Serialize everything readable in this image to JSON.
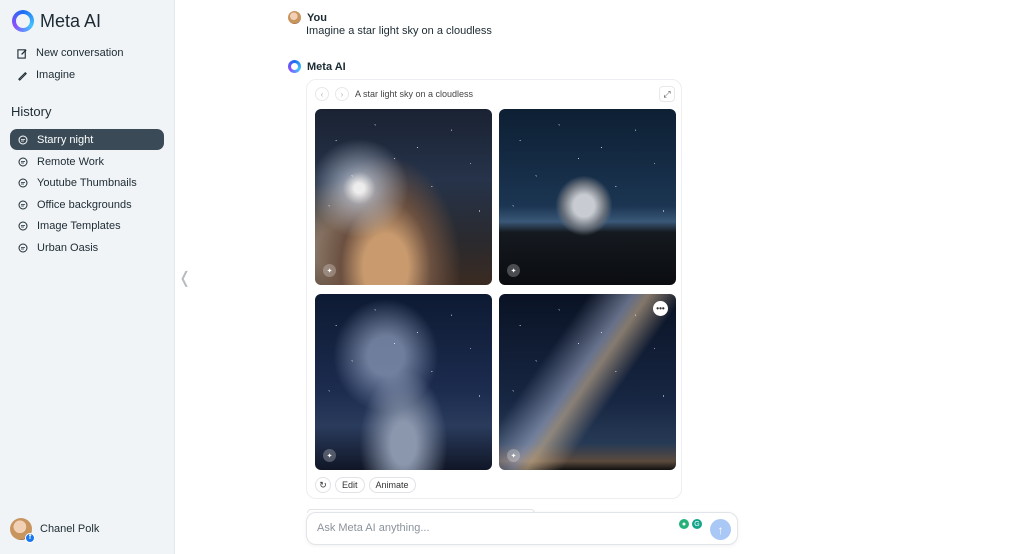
{
  "app": {
    "title": "Meta AI"
  },
  "sidebar": {
    "nav": [
      {
        "label": "New conversation",
        "icon": "edit-icon"
      },
      {
        "label": "Imagine",
        "icon": "pencil-icon"
      }
    ],
    "history_title": "History",
    "history": [
      {
        "label": "Starry night",
        "active": true
      },
      {
        "label": "Remote Work",
        "active": false
      },
      {
        "label": "Youtube Thumbnails",
        "active": false
      },
      {
        "label": "Office backgrounds",
        "active": false
      },
      {
        "label": "Image Templates",
        "active": false
      },
      {
        "label": "Urban Oasis",
        "active": false
      }
    ],
    "user_name": "Chanel Polk"
  },
  "chat": {
    "user_name": "You",
    "user_message": "Imagine a star light sky on a cloudless",
    "ai_name": "Meta AI",
    "card": {
      "prompt": "A star light sky on a cloudless",
      "actions": {
        "edit": "Edit",
        "animate": "Animate"
      }
    }
  },
  "composer": {
    "placeholder": "Ask Meta AI anything..."
  },
  "colors": {
    "accent": "#1d6cf0",
    "active_history": "#3a4b57",
    "send_button": "#a9c8f5"
  }
}
